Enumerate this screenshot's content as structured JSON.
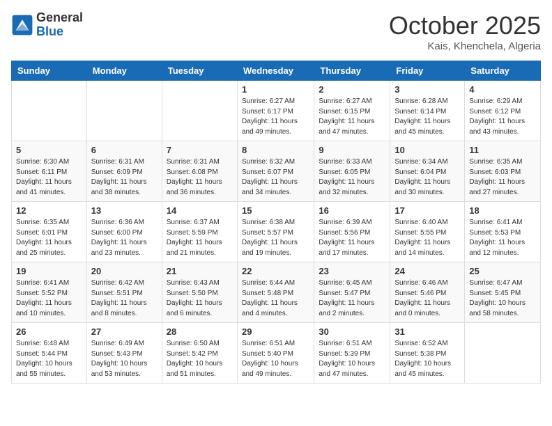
{
  "logo": {
    "general": "General",
    "blue": "Blue"
  },
  "header": {
    "title": "October 2025",
    "location": "Kais, Khenchela, Algeria"
  },
  "weekdays": [
    "Sunday",
    "Monday",
    "Tuesday",
    "Wednesday",
    "Thursday",
    "Friday",
    "Saturday"
  ],
  "weeks": [
    [
      {
        "day": "",
        "info": ""
      },
      {
        "day": "",
        "info": ""
      },
      {
        "day": "",
        "info": ""
      },
      {
        "day": "1",
        "info": "Sunrise: 6:27 AM\nSunset: 6:17 PM\nDaylight: 11 hours and 49 minutes."
      },
      {
        "day": "2",
        "info": "Sunrise: 6:27 AM\nSunset: 6:15 PM\nDaylight: 11 hours and 47 minutes."
      },
      {
        "day": "3",
        "info": "Sunrise: 6:28 AM\nSunset: 6:14 PM\nDaylight: 11 hours and 45 minutes."
      },
      {
        "day": "4",
        "info": "Sunrise: 6:29 AM\nSunset: 6:12 PM\nDaylight: 11 hours and 43 minutes."
      }
    ],
    [
      {
        "day": "5",
        "info": "Sunrise: 6:30 AM\nSunset: 6:11 PM\nDaylight: 11 hours and 41 minutes."
      },
      {
        "day": "6",
        "info": "Sunrise: 6:31 AM\nSunset: 6:09 PM\nDaylight: 11 hours and 38 minutes."
      },
      {
        "day": "7",
        "info": "Sunrise: 6:31 AM\nSunset: 6:08 PM\nDaylight: 11 hours and 36 minutes."
      },
      {
        "day": "8",
        "info": "Sunrise: 6:32 AM\nSunset: 6:07 PM\nDaylight: 11 hours and 34 minutes."
      },
      {
        "day": "9",
        "info": "Sunrise: 6:33 AM\nSunset: 6:05 PM\nDaylight: 11 hours and 32 minutes."
      },
      {
        "day": "10",
        "info": "Sunrise: 6:34 AM\nSunset: 6:04 PM\nDaylight: 11 hours and 30 minutes."
      },
      {
        "day": "11",
        "info": "Sunrise: 6:35 AM\nSunset: 6:03 PM\nDaylight: 11 hours and 27 minutes."
      }
    ],
    [
      {
        "day": "12",
        "info": "Sunrise: 6:35 AM\nSunset: 6:01 PM\nDaylight: 11 hours and 25 minutes."
      },
      {
        "day": "13",
        "info": "Sunrise: 6:36 AM\nSunset: 6:00 PM\nDaylight: 11 hours and 23 minutes."
      },
      {
        "day": "14",
        "info": "Sunrise: 6:37 AM\nSunset: 5:59 PM\nDaylight: 11 hours and 21 minutes."
      },
      {
        "day": "15",
        "info": "Sunrise: 6:38 AM\nSunset: 5:57 PM\nDaylight: 11 hours and 19 minutes."
      },
      {
        "day": "16",
        "info": "Sunrise: 6:39 AM\nSunset: 5:56 PM\nDaylight: 11 hours and 17 minutes."
      },
      {
        "day": "17",
        "info": "Sunrise: 6:40 AM\nSunset: 5:55 PM\nDaylight: 11 hours and 14 minutes."
      },
      {
        "day": "18",
        "info": "Sunrise: 6:41 AM\nSunset: 5:53 PM\nDaylight: 11 hours and 12 minutes."
      }
    ],
    [
      {
        "day": "19",
        "info": "Sunrise: 6:41 AM\nSunset: 5:52 PM\nDaylight: 11 hours and 10 minutes."
      },
      {
        "day": "20",
        "info": "Sunrise: 6:42 AM\nSunset: 5:51 PM\nDaylight: 11 hours and 8 minutes."
      },
      {
        "day": "21",
        "info": "Sunrise: 6:43 AM\nSunset: 5:50 PM\nDaylight: 11 hours and 6 minutes."
      },
      {
        "day": "22",
        "info": "Sunrise: 6:44 AM\nSunset: 5:48 PM\nDaylight: 11 hours and 4 minutes."
      },
      {
        "day": "23",
        "info": "Sunrise: 6:45 AM\nSunset: 5:47 PM\nDaylight: 11 hours and 2 minutes."
      },
      {
        "day": "24",
        "info": "Sunrise: 6:46 AM\nSunset: 5:46 PM\nDaylight: 11 hours and 0 minutes."
      },
      {
        "day": "25",
        "info": "Sunrise: 6:47 AM\nSunset: 5:45 PM\nDaylight: 10 hours and 58 minutes."
      }
    ],
    [
      {
        "day": "26",
        "info": "Sunrise: 6:48 AM\nSunset: 5:44 PM\nDaylight: 10 hours and 55 minutes."
      },
      {
        "day": "27",
        "info": "Sunrise: 6:49 AM\nSunset: 5:43 PM\nDaylight: 10 hours and 53 minutes."
      },
      {
        "day": "28",
        "info": "Sunrise: 6:50 AM\nSunset: 5:42 PM\nDaylight: 10 hours and 51 minutes."
      },
      {
        "day": "29",
        "info": "Sunrise: 6:51 AM\nSunset: 5:40 PM\nDaylight: 10 hours and 49 minutes."
      },
      {
        "day": "30",
        "info": "Sunrise: 6:51 AM\nSunset: 5:39 PM\nDaylight: 10 hours and 47 minutes."
      },
      {
        "day": "31",
        "info": "Sunrise: 6:52 AM\nSunset: 5:38 PM\nDaylight: 10 hours and 45 minutes."
      },
      {
        "day": "",
        "info": ""
      }
    ]
  ]
}
